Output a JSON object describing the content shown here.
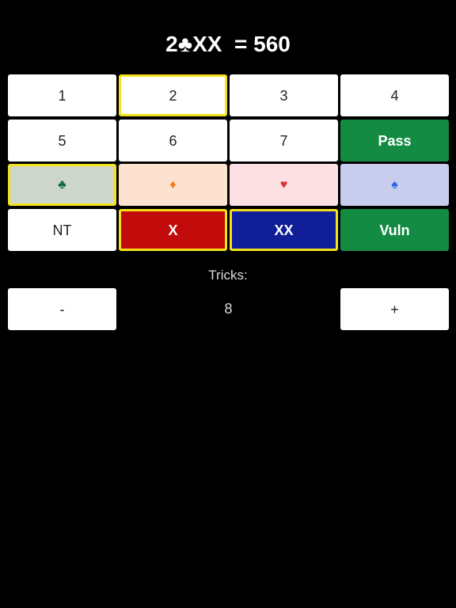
{
  "title": "2♣XX  = 560",
  "level_buttons": [
    "1",
    "2",
    "3",
    "4",
    "5",
    "6",
    "7"
  ],
  "selected_level": "2",
  "pass_label": "Pass",
  "suits": {
    "clubs": "♣",
    "diamonds": "♦",
    "hearts": "♥",
    "spades": "♠"
  },
  "selected_suit": "clubs",
  "nt_label": "NT",
  "double_label": "X",
  "redouble_label": "XX",
  "vuln_label": "Vuln",
  "tricks": {
    "label": "Tricks:",
    "value": "8",
    "minus_label": "-",
    "plus_label": "+"
  },
  "colors": {
    "selected_border": "#f4e21b",
    "green": "#138b43",
    "double_red": "#c20b0b",
    "redouble_blue": "#101e98"
  }
}
